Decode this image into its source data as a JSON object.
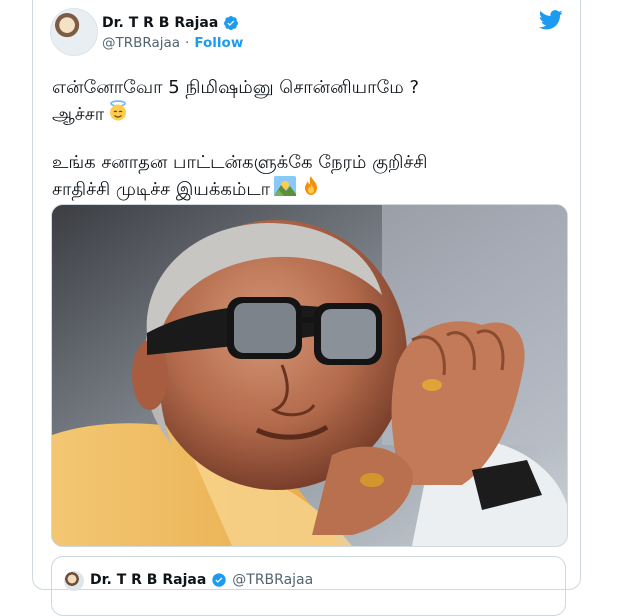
{
  "author": {
    "display_name": "Dr. T R B Rajaa",
    "handle": "@TRBRajaa",
    "follow_label": "Follow",
    "separator": "·"
  },
  "tweet": {
    "line1": "என்னோவோ 5 நிமிஷம்னு சொன்னியாமே ?",
    "line2": "ஆச்சா",
    "line3": "உங்க சனாதன பாட்டன்களுக்கே நேரம் குறிச்சி",
    "line4": "சாதிச்சி முடிச்ச  இயக்கம்டா",
    "emojis": [
      "innocent-face-emoji",
      "sunrise-over-mountains-emoji",
      "fire-emoji"
    ]
  },
  "quoted_tweet": {
    "display_name": "Dr. T R B Rajaa",
    "handle": "@TRBRajaa"
  },
  "colors": {
    "accent": "#1d9bf0",
    "text": "#0f1419",
    "muted": "#536471",
    "border": "#cfd9de"
  }
}
